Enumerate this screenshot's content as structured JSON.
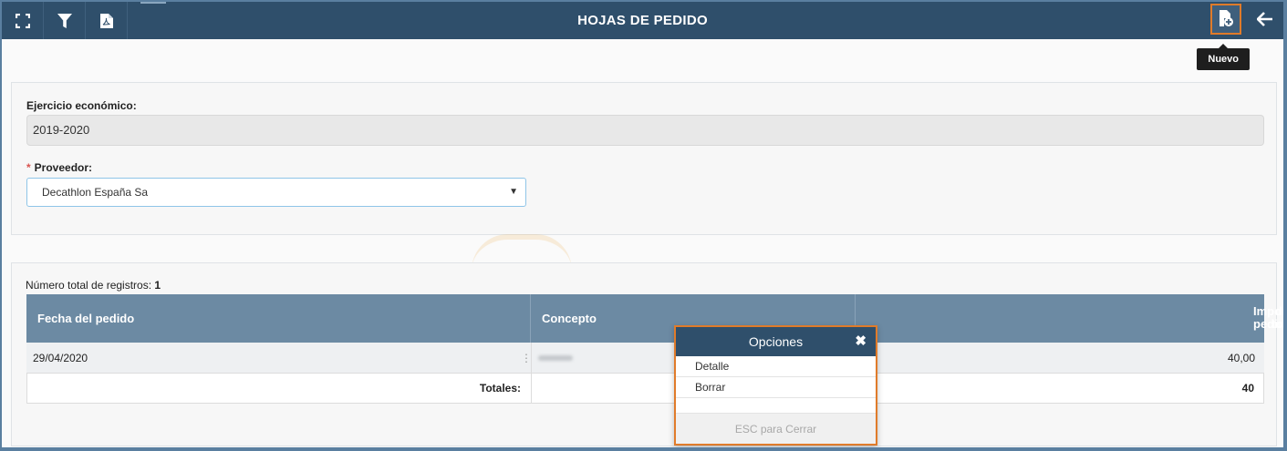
{
  "topbar": {
    "title": "HOJAS DE PEDIDO",
    "icons": [
      "expand-icon",
      "filter-icon",
      "pdf-icon",
      "new-document-icon",
      "back-arrow-icon"
    ],
    "tooltip": "Nuevo"
  },
  "form": {
    "ejercicio_label": "Ejercicio económico:",
    "ejercicio_value": "2019-2020",
    "proveedor_required": "*",
    "proveedor_label": "Proveedor:",
    "proveedor_value": "Decathlon España Sa"
  },
  "grid": {
    "count_label": "Número total de registros:",
    "count_value": "1",
    "headers": {
      "fecha": "Fecha del pedido",
      "concepto": "Concepto",
      "importe_line1": "Importe total",
      "importe_line2": "del pedido"
    },
    "rows": [
      {
        "fecha": "29/04/2020",
        "importe": "40,00"
      }
    ],
    "totals_label": "Totales:",
    "totals_value": "40"
  },
  "popup": {
    "title": "Opciones",
    "close": "✖",
    "items": [
      "Detalle",
      "Borrar"
    ],
    "footer": "ESC para Cerrar"
  },
  "colors": {
    "topbar": "#2f4f6b",
    "grid_header": "#6c8aa3",
    "highlight": "#e07b2a"
  }
}
